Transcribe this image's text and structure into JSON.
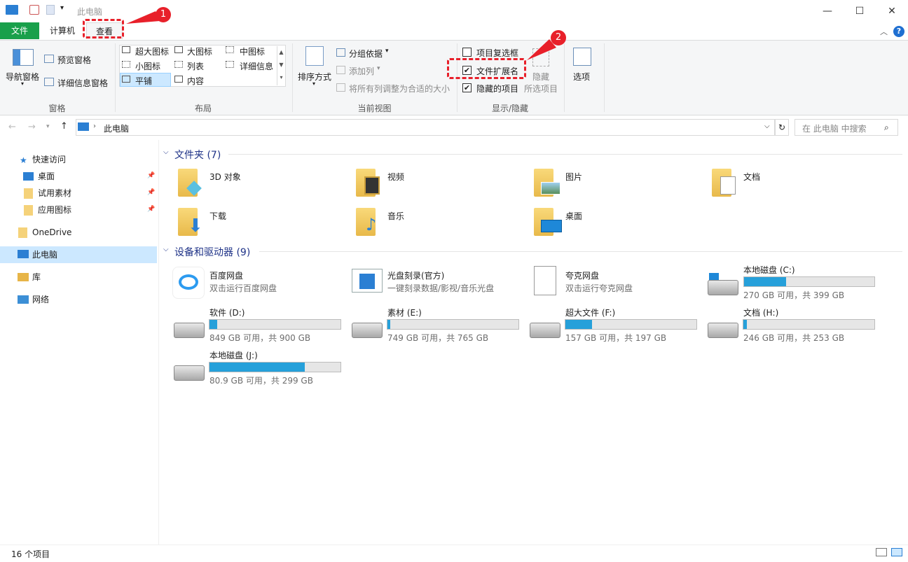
{
  "window": {
    "title": "此电脑"
  },
  "controls": {
    "minimize": "—",
    "maximize": "☐",
    "close": "✕"
  },
  "tabs": {
    "file": "文件",
    "computer": "计算机",
    "view": "查看"
  },
  "ribbon": {
    "pane": {
      "nav_pane": "导航窗格",
      "preview_pane": "预览窗格",
      "details_pane": "详细信息窗格",
      "group": "窗格"
    },
    "layout": {
      "xl_icons": "超大图标",
      "l_icons": "大图标",
      "m_icons": "中图标",
      "s_icons": "小图标",
      "list": "列表",
      "details": "详细信息",
      "tiles": "平铺",
      "content": "内容",
      "group": "布局"
    },
    "current_view": {
      "sort": "排序方式",
      "group_by": "分组依据",
      "add_col": "添加列",
      "fit_cols": "将所有列调整为合适的大小",
      "group": "当前视图"
    },
    "show_hide": {
      "item_checkboxes": "项目复选框",
      "file_ext": "文件扩展名",
      "hidden_items": "隐藏的项目",
      "hide": "隐藏",
      "selected_items": "所选项目",
      "group": "显示/隐藏"
    },
    "options": "选项"
  },
  "address": {
    "path": "此电脑",
    "search_placeholder": "在 此电脑 中搜索"
  },
  "nav": {
    "quick_access": "快速访问",
    "desktop": "桌面",
    "trial": "试用素材",
    "app_icons": "应用图标",
    "onedrive": "OneDrive",
    "this_pc": "此电脑",
    "library": "库",
    "network": "网络"
  },
  "folders_section": "文件夹 (7)",
  "folders": [
    "3D 对象",
    "视频",
    "图片",
    "文档",
    "下载",
    "音乐",
    "桌面"
  ],
  "devices_section": "设备和驱动器 (9)",
  "apps": [
    {
      "name": "百度网盘",
      "desc": "双击运行百度网盘"
    },
    {
      "name": "光盘刻录(官方)",
      "desc": "一键刻录数据/影视/音乐光盘"
    },
    {
      "name": "夸克网盘",
      "desc": "双击运行夸克网盘"
    }
  ],
  "drives": [
    {
      "name": "本地磁盘 (C:)",
      "info": "270 GB 可用，共 399 GB",
      "used": 0.323
    },
    {
      "name": "软件 (D:)",
      "info": "849 GB 可用，共 900 GB",
      "used": 0.057
    },
    {
      "name": "素材 (E:)",
      "info": "749 GB 可用，共 765 GB",
      "used": 0.021
    },
    {
      "name": "超大文件 (F:)",
      "info": "157 GB 可用，共 197 GB",
      "used": 0.203
    },
    {
      "name": "文档 (H:)",
      "info": "246 GB 可用，共 253 GB",
      "used": 0.028
    },
    {
      "name": "本地磁盘 (J:)",
      "info": "80.9 GB 可用，共 299 GB",
      "used": 0.729
    }
  ],
  "status": {
    "count": "16 个项目"
  },
  "annotations": {
    "one": "1",
    "two": "2"
  },
  "colors": {
    "accent": "#26a0da",
    "file_tab": "#19a04b",
    "annotation": "#e8202a"
  }
}
